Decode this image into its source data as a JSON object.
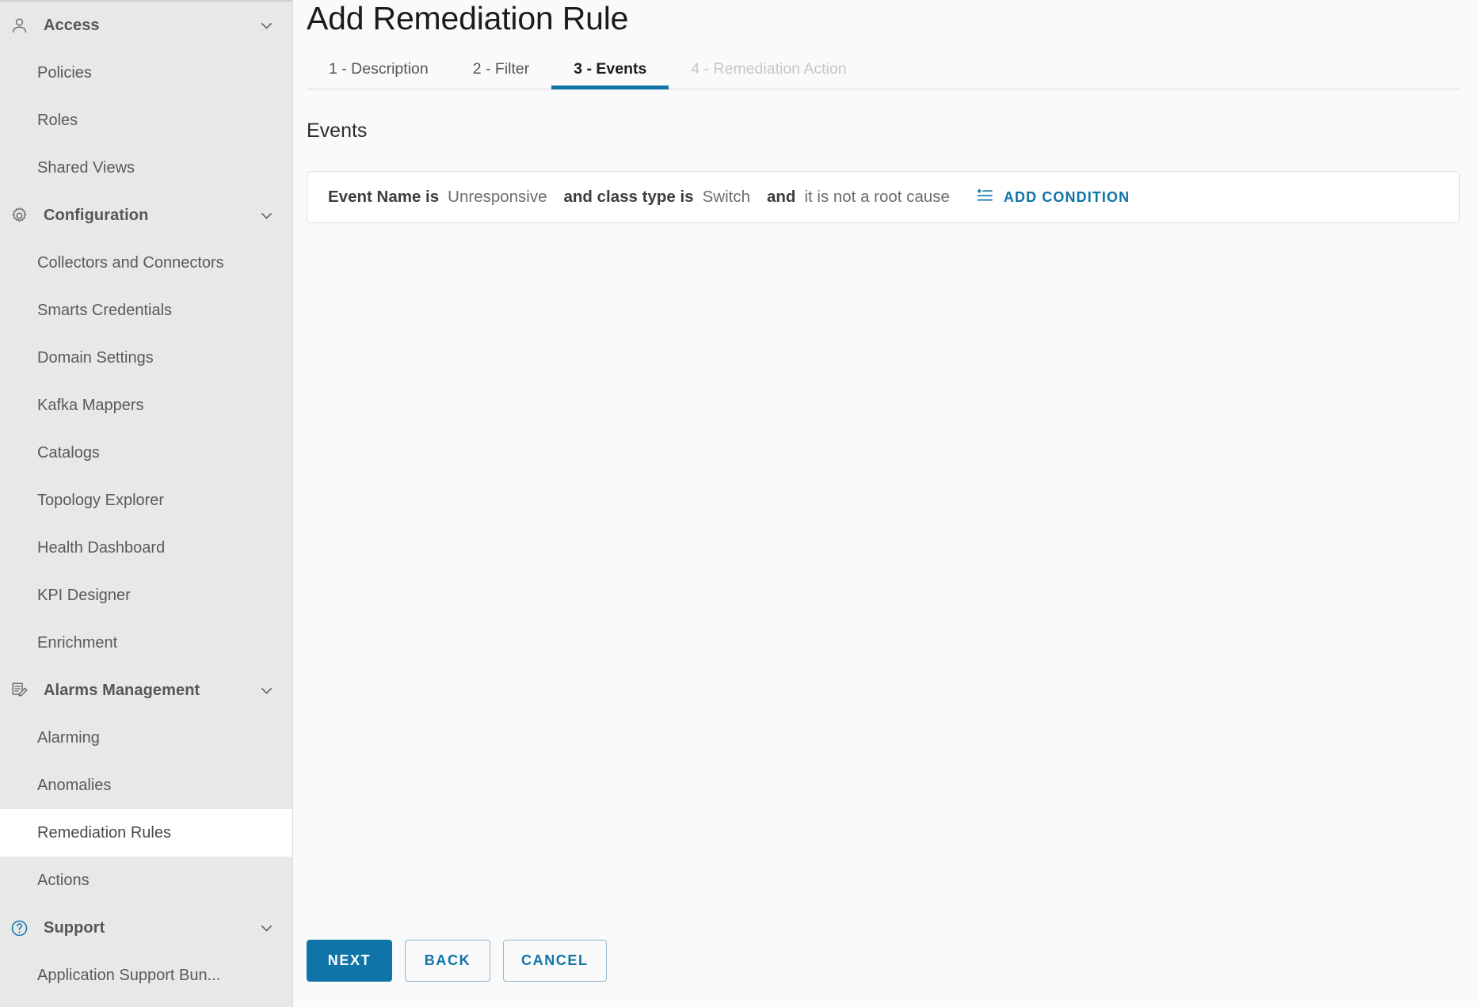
{
  "sidebar": {
    "groups": [
      {
        "label": "Access",
        "icon": "user-icon",
        "expanded": true,
        "chevron": "chevron-down-icon",
        "items": [
          {
            "label": "Policies",
            "selected": false
          },
          {
            "label": "Roles",
            "selected": false
          },
          {
            "label": "Shared Views",
            "selected": false
          }
        ]
      },
      {
        "label": "Configuration",
        "icon": "gear-icon",
        "expanded": true,
        "chevron": "chevron-down-icon",
        "items": [
          {
            "label": "Collectors and Connectors",
            "selected": false
          },
          {
            "label": "Smarts Credentials",
            "selected": false
          },
          {
            "label": "Domain Settings",
            "selected": false
          },
          {
            "label": "Kafka Mappers",
            "selected": false
          },
          {
            "label": "Catalogs",
            "selected": false
          },
          {
            "label": "Topology Explorer",
            "selected": false
          },
          {
            "label": "Health Dashboard",
            "selected": false
          },
          {
            "label": "KPI Designer",
            "selected": false
          },
          {
            "label": "Enrichment",
            "selected": false
          }
        ]
      },
      {
        "label": "Alarms Management",
        "icon": "document-edit-icon",
        "expanded": true,
        "chevron": "chevron-down-icon",
        "items": [
          {
            "label": "Alarming",
            "selected": false
          },
          {
            "label": "Anomalies",
            "selected": false
          },
          {
            "label": "Remediation Rules",
            "selected": true
          },
          {
            "label": "Actions",
            "selected": false
          }
        ]
      },
      {
        "label": "Support",
        "icon": "help-circle-icon",
        "expanded": true,
        "chevron": "chevron-down-icon",
        "items": [
          {
            "label": "Application Support Bun...",
            "selected": false
          }
        ]
      }
    ]
  },
  "header": {
    "title": "Add Remediation Rule"
  },
  "tabs": [
    {
      "label": "1 - Description",
      "state": "enabled"
    },
    {
      "label": "2 - Filter",
      "state": "enabled"
    },
    {
      "label": "3 - Events",
      "state": "active"
    },
    {
      "label": "4 - Remediation Action",
      "state": "disabled"
    }
  ],
  "main": {
    "section_title": "Events",
    "condition": {
      "parts": [
        {
          "type": "key",
          "text": "Event Name is"
        },
        {
          "type": "value",
          "text": "Unresponsive"
        },
        {
          "type": "key",
          "text": "and class type is"
        },
        {
          "type": "value",
          "text": "Switch"
        },
        {
          "type": "key",
          "text": "and"
        },
        {
          "type": "value",
          "text": "it is not a root cause"
        }
      ],
      "add_condition_label": "ADD CONDITION",
      "add_condition_icon": "add-list-item-icon"
    }
  },
  "footer": {
    "buttons": [
      {
        "label": "NEXT",
        "style": "primary"
      },
      {
        "label": "BACK",
        "style": "outline"
      },
      {
        "label": "CANCEL",
        "style": "outline"
      }
    ]
  },
  "colors": {
    "accent": "#0f74a8",
    "sidebar_bg": "#e8e8e8",
    "main_bg": "#fafafa",
    "selected_bg": "#ffffff",
    "disabled_text": "#c6c6c6"
  }
}
